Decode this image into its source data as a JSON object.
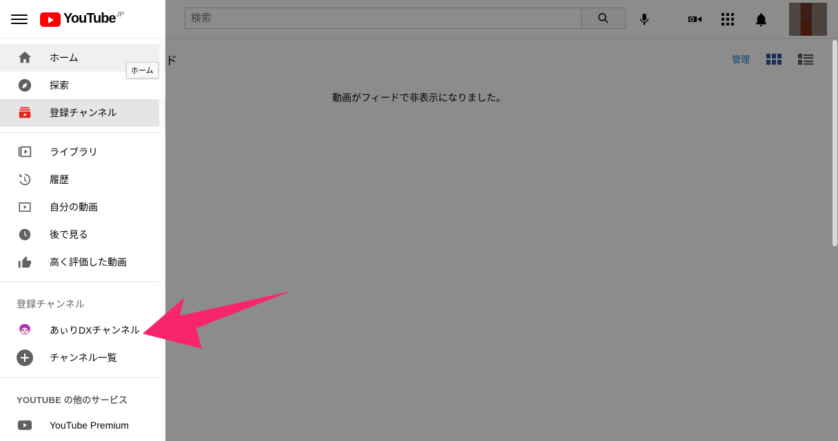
{
  "app": {
    "name": "YouTube",
    "country_code": "JP"
  },
  "header": {
    "menu_icon": "hamburger-menu-icon",
    "search": {
      "value": "",
      "placeholder": "検索"
    },
    "search_button_icon": "search-icon",
    "mic_icon": "microphone-icon",
    "create_icon": "video-add-icon",
    "apps_icon": "apps-grid-icon",
    "notifications_icon": "bell-icon",
    "avatar_icon": "user-avatar"
  },
  "subheader": {
    "page_title_partial": "ド",
    "manage_label": "管理",
    "grid_view_icon": "grid-view-icon",
    "list_view_icon": "list-view-icon",
    "grid_active_color": "#2a5699",
    "list_inactive_color": "#606060"
  },
  "main": {
    "empty_message": "動画がフィードで非表示になりました。"
  },
  "tooltip": {
    "text": "ホーム"
  },
  "sidebar": {
    "primary": [
      {
        "label": "ホーム",
        "icon": "home-icon",
        "state": "hovered"
      },
      {
        "label": "探索",
        "icon": "explore-compass-icon",
        "state": "default"
      },
      {
        "label": "登録チャンネル",
        "icon": "subscriptions-icon",
        "state": "active"
      }
    ],
    "library": [
      {
        "label": "ライブラリ",
        "icon": "library-icon"
      },
      {
        "label": "履歴",
        "icon": "history-icon"
      },
      {
        "label": "自分の動画",
        "icon": "my-videos-icon"
      },
      {
        "label": "後で見る",
        "icon": "watch-later-clock-icon"
      },
      {
        "label": "高く評価した動画",
        "icon": "thumbs-up-icon"
      }
    ],
    "subscriptions_title": "登録チャンネル",
    "subscriptions": [
      {
        "label": "あぃりDXチャンネル",
        "icon": "channel-avatar"
      },
      {
        "label": "チャンネル一覧",
        "icon": "plus-circle-icon"
      }
    ],
    "more_title": "YOUTUBE の他のサービス",
    "more": [
      {
        "label": "YouTube Premium",
        "icon": "youtube-premium-icon"
      }
    ]
  },
  "annotation": {
    "arrow_color": "#f7266a",
    "arrow_target": "あぃりDXチャンネル"
  },
  "colors": {
    "brand_red": "#ff0000",
    "link_blue": "#167ac6",
    "text_primary": "#030303",
    "text_secondary": "#606060",
    "overlay": "rgba(0,0,0,0.45)"
  }
}
